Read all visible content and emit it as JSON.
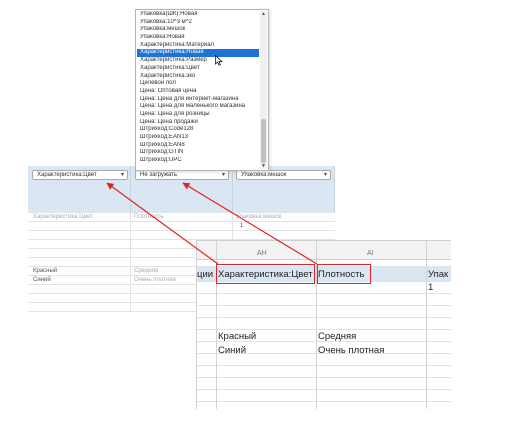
{
  "mapping_table": {
    "selects": [
      {
        "value": "Характеристика:Цвет"
      },
      {
        "value": "Не загружать"
      },
      {
        "value": "Упаковка:мешок"
      }
    ],
    "preview_header": [
      "Характеристика:Цвет",
      "Плотность",
      "Упаковка:мешок"
    ],
    "preview_values": [
      "1"
    ],
    "rows": [
      {
        "color": "Красный",
        "density": "Средняя"
      },
      {
        "color": "Синий",
        "density": "Очень плотная"
      }
    ]
  },
  "dropdown": {
    "items": [
      "Упаковка(ШК):Новая",
      "Упаковка:10^3 м^2",
      "Упаковка:мешок",
      "Упаковка:Новая",
      "Характеристика:Материал",
      "Характеристика:Новая",
      "Характеристика:Размер",
      "Характеристика:Цвет",
      "Характеристика:эко",
      "Целевой пол",
      "Цена: Оптовая цена",
      "Цена: Цена для интернет-магазина",
      "Цена: Цена для маленького магазина",
      "Цена: Цена для розницы",
      "Цена: Цена продажи",
      "Штрихкод:Code128",
      "Штрихкод:EAN13",
      "Штрихкод:EAN8",
      "Штрихкод:GTIN",
      "Штрихкод:UPC"
    ],
    "selected_index": 5,
    "scroll_up": "▲",
    "scroll_down": "▼"
  },
  "spreadsheet": {
    "col_headers": [
      "AH",
      "AI"
    ],
    "cut_left": "ции",
    "header_cells": [
      "Характеристика:Цвет",
      "Плотность",
      "Упак"
    ],
    "row2_values": [
      "1"
    ],
    "rows": [
      {
        "color": "Красный",
        "density": "Средняя"
      },
      {
        "color": "Синий",
        "density": "Очень плотная"
      }
    ]
  },
  "colors": {
    "highlight": "#1e73d6",
    "annotation": "#e02424",
    "header_band": "#dbe6f3"
  },
  "icons": {
    "caret": "▾"
  }
}
